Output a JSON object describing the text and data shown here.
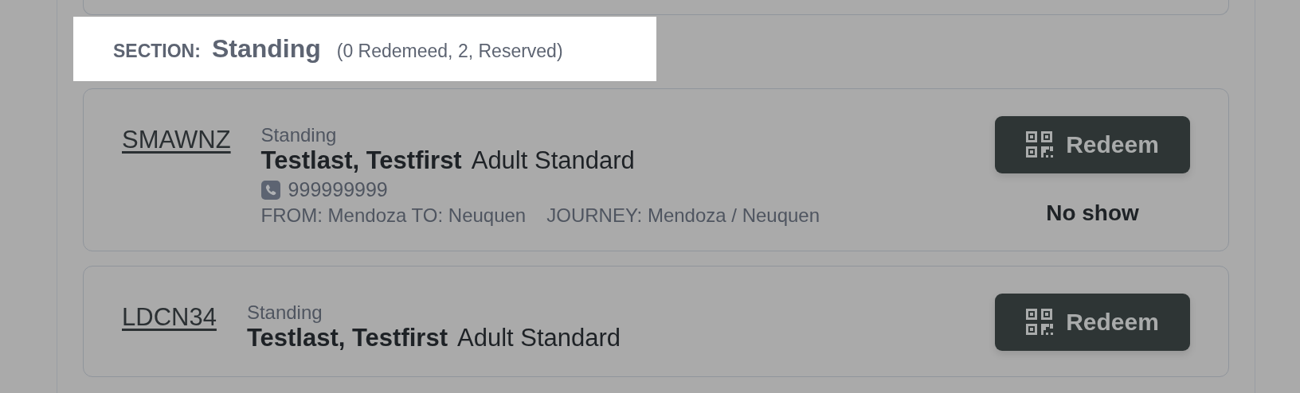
{
  "section": {
    "label": "SECTION:",
    "name": "Standing",
    "summary": "(0 Redemeed, 2, Reserved)"
  },
  "tickets": [
    {
      "code": "SMAWNZ",
      "section": "Standing",
      "passenger": "Testlast, Testfirst",
      "fare": "Adult Standard",
      "phone": "999999999",
      "route": "FROM: Mendoza TO: Neuquen",
      "journey": "JOURNEY: Mendoza / Neuquen",
      "action": "Redeem",
      "status": "No show"
    },
    {
      "code": "LDCN34",
      "section": "Standing",
      "passenger": "Testlast, Testfirst",
      "fare": "Adult Standard",
      "action": "Redeem"
    }
  ]
}
